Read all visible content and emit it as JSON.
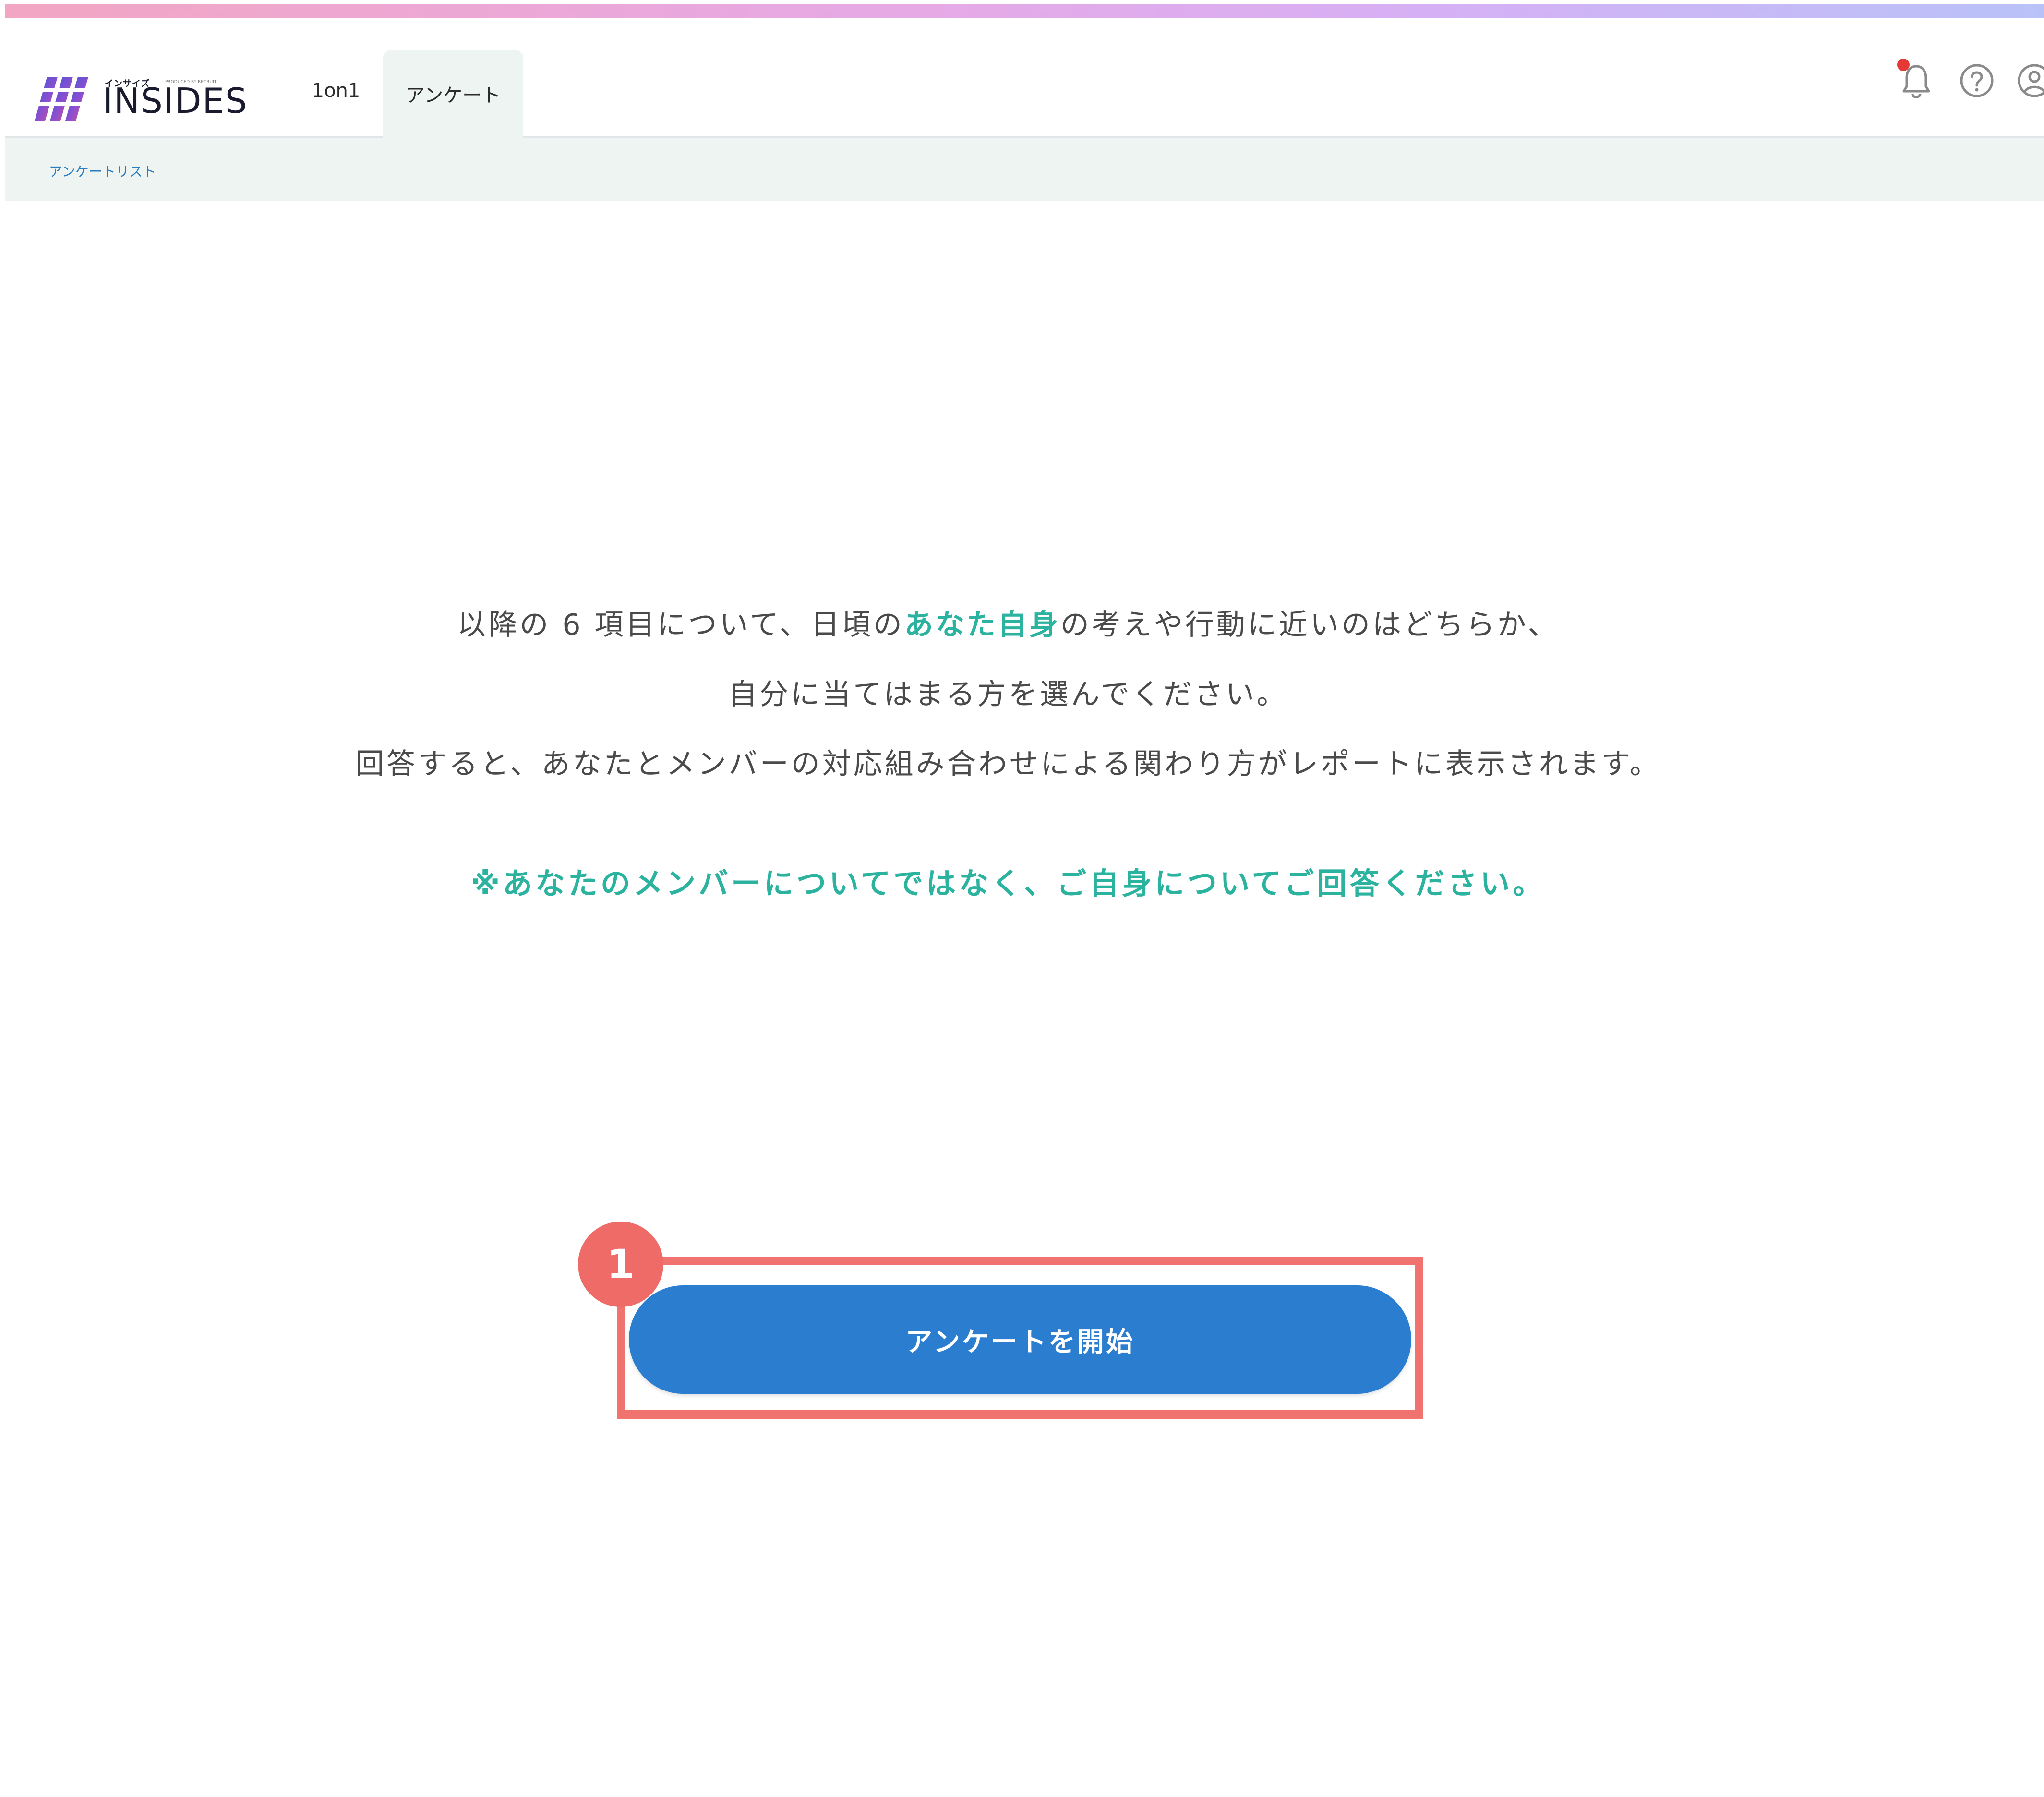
{
  "app": {
    "logo_small": "インサイズ",
    "logo_by": "PRODUCED BY RECRUIT",
    "logo_text": "INSIDES"
  },
  "nav": {
    "tabs": [
      {
        "label": "1on1",
        "active": false
      },
      {
        "label": "アンケート",
        "active": true
      }
    ]
  },
  "header_icons": {
    "notification": "bell-icon",
    "help": "help-circle-icon",
    "account": "user-circle-icon",
    "notification_dot_color": "#e53935"
  },
  "breadcrumb": {
    "label": "アンケートリスト"
  },
  "instructions": {
    "line1_before": "以降の 6 項目について、日頃の",
    "line1_highlight": "あなた自身",
    "line1_after": "の考えや行動に近いのはどちらか、",
    "line2": "自分に当てはまる方を選んでください。",
    "line3": "回答すると、あなたとメンバーの対応組み合わせによる関わり方がレポートに表示されます。",
    "note": "※あなたのメンバーについてではなく、ご自身についてご回答ください。"
  },
  "start_button": {
    "label": "アンケートを開始"
  },
  "annotation": {
    "step_number": "1"
  },
  "colors": {
    "accent_teal": "#2bb3a0",
    "button_blue": "#2a7dcf",
    "annotation_red": "#f0736f",
    "subheader_bg": "#eef4f1"
  }
}
